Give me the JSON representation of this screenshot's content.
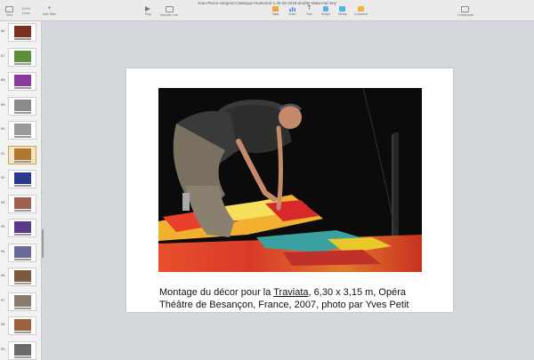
{
  "window": {
    "title": "Jean-Pierre-Sergent-Catalogue-Raisonné-1.28-06-2019-double-Mata-Hari.key"
  },
  "toolbar": {
    "view": "View",
    "zoom": "101%",
    "add_slide": "Add Slide",
    "play": "Play",
    "keynote_live": "Keynote Live",
    "table": "Table",
    "chart": "Chart",
    "text": "Text",
    "shape": "Shape",
    "media": "Media",
    "comment": "Comment",
    "collaborate": "Collaborate"
  },
  "sidebar": {
    "slides": [
      {
        "num": "86",
        "color": "#7a3020"
      },
      {
        "num": "87",
        "color": "#5c8f3a"
      },
      {
        "num": "88",
        "color": "#8a3a9a"
      },
      {
        "num": "89",
        "color": "#8a8a8a"
      },
      {
        "num": "90",
        "color": "#9a9a9a"
      },
      {
        "num": "91",
        "color": "#b07830"
      },
      {
        "num": "92",
        "color": "#2a3a8a"
      },
      {
        "num": "93",
        "color": "#a06050"
      },
      {
        "num": "94",
        "color": "#5a3a8a"
      },
      {
        "num": "95",
        "color": "#6a6a9a"
      },
      {
        "num": "96",
        "color": "#7a5a40"
      },
      {
        "num": "97",
        "color": "#8a7a6a"
      },
      {
        "num": "98",
        "color": "#9a6040"
      },
      {
        "num": "99",
        "color": "#6a6a6a"
      }
    ],
    "selected": "91"
  },
  "slide": {
    "caption_line1_pre": "Montage du décor pour la ",
    "caption_line1_title": "Traviata",
    "caption_line1_post": ", 6,30 x 3,15 m, Opéra",
    "caption_line2": "Théâtre de Besançon, France, 2007, photo par Yves Petit"
  }
}
